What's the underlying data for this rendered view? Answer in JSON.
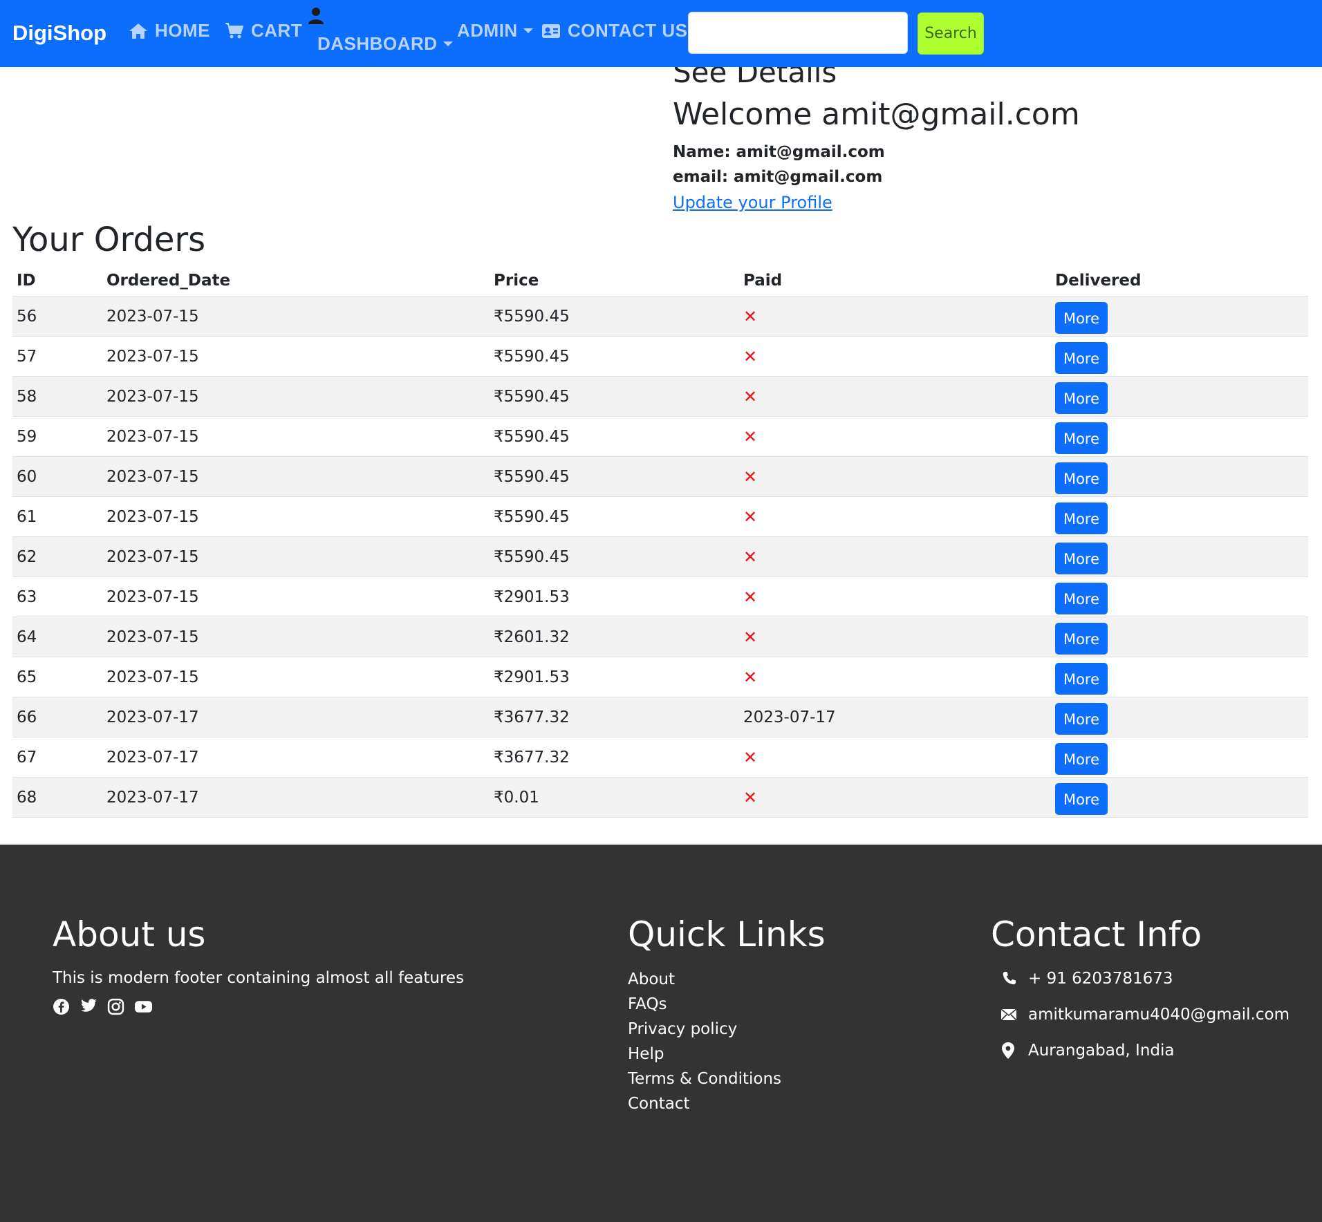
{
  "nav": {
    "brand": "DigiShop",
    "home": "HOME",
    "cart": "CART",
    "dashboard": "DASHBOARD",
    "admin": "ADMIN",
    "contact": "CONTACT US",
    "search_placeholder": "",
    "search_button": "Search"
  },
  "profile": {
    "see_details": "See Details",
    "welcome": "Welcome amit@gmail.com",
    "name_line": "Name: amit@gmail.com",
    "email_line": "email: amit@gmail.com",
    "update_link": "Update your Profile"
  },
  "orders": {
    "title": "Your Orders",
    "headers": [
      "ID",
      "Ordered_Date",
      "Price",
      "Paid",
      "Delivered"
    ],
    "more_label": "More",
    "rows": [
      {
        "id": "56",
        "date": "2023-07-15",
        "price": "₹5590.45",
        "paid": "✕",
        "paid_is_date": false
      },
      {
        "id": "57",
        "date": "2023-07-15",
        "price": "₹5590.45",
        "paid": "✕",
        "paid_is_date": false
      },
      {
        "id": "58",
        "date": "2023-07-15",
        "price": "₹5590.45",
        "paid": "✕",
        "paid_is_date": false
      },
      {
        "id": "59",
        "date": "2023-07-15",
        "price": "₹5590.45",
        "paid": "✕",
        "paid_is_date": false
      },
      {
        "id": "60",
        "date": "2023-07-15",
        "price": "₹5590.45",
        "paid": "✕",
        "paid_is_date": false
      },
      {
        "id": "61",
        "date": "2023-07-15",
        "price": "₹5590.45",
        "paid": "✕",
        "paid_is_date": false
      },
      {
        "id": "62",
        "date": "2023-07-15",
        "price": "₹5590.45",
        "paid": "✕",
        "paid_is_date": false
      },
      {
        "id": "63",
        "date": "2023-07-15",
        "price": "₹2901.53",
        "paid": "✕",
        "paid_is_date": false
      },
      {
        "id": "64",
        "date": "2023-07-15",
        "price": "₹2601.32",
        "paid": "✕",
        "paid_is_date": false
      },
      {
        "id": "65",
        "date": "2023-07-15",
        "price": "₹2901.53",
        "paid": "✕",
        "paid_is_date": false
      },
      {
        "id": "66",
        "date": "2023-07-17",
        "price": "₹3677.32",
        "paid": "2023-07-17",
        "paid_is_date": true
      },
      {
        "id": "67",
        "date": "2023-07-17",
        "price": "₹3677.32",
        "paid": "✕",
        "paid_is_date": false
      },
      {
        "id": "68",
        "date": "2023-07-17",
        "price": "₹0.01",
        "paid": "✕",
        "paid_is_date": false
      }
    ]
  },
  "footer": {
    "about_title": "About us",
    "about_text": "This is modern footer containing almost all features",
    "social_icons": [
      "facebook-icon",
      "twitter-icon",
      "instagram-icon",
      "youtube-icon"
    ],
    "links_title": "Quick Links",
    "links": [
      "About",
      "FAQs",
      "Privacy policy",
      "Help",
      "Terms & Conditions",
      "Contact"
    ],
    "contact_title": "Contact Info",
    "phone": "+ 91 6203781673",
    "email": "amitkumaramu4040@gmail.com",
    "location": "Aurangabad, India"
  },
  "colors": {
    "navbar": "#0d6efd",
    "search_button": "#adff2f",
    "more_button": "#0d6efd",
    "cross": "#ee1111",
    "footer": "#333333"
  }
}
